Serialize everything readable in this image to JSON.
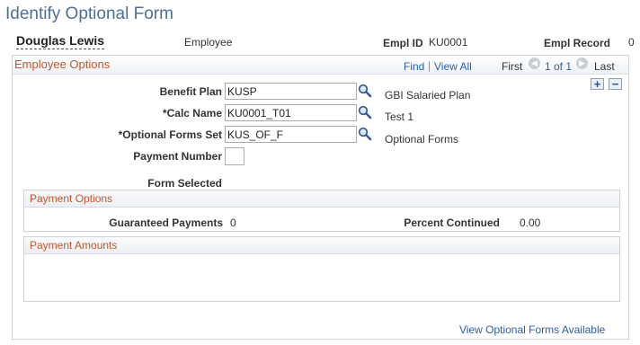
{
  "page": {
    "title": "Identify Optional Form"
  },
  "employee": {
    "name": "Douglas Lewis",
    "role": "Employee",
    "empl_id_label": "Empl ID",
    "empl_id": "KU0001",
    "empl_record_label": "Empl Record",
    "empl_record": "0"
  },
  "employee_options": {
    "title": "Employee Options",
    "nav": {
      "find": "Find",
      "separator": "|",
      "view_all": "View All",
      "first": "First",
      "page_info": "1 of 1",
      "last": "Last"
    },
    "add_symbol": "+",
    "delete_symbol": "−",
    "fields": {
      "benefit_plan": {
        "label": "Benefit Plan",
        "value": "KUSP",
        "description": "GBI Salaried Plan"
      },
      "calc_name": {
        "label": "*Calc Name",
        "value": "KU0001_T01",
        "description": "Test 1"
      },
      "optional_forms_set": {
        "label": "*Optional Forms Set",
        "value": "KUS_OF_F",
        "description": "Optional Forms"
      },
      "payment_number": {
        "label": "Payment Number",
        "value": ""
      },
      "form_selected": {
        "label": "Form Selected"
      }
    }
  },
  "payment_options": {
    "title": "Payment Options",
    "guaranteed_label": "Guaranteed Payments",
    "guaranteed_value": "0",
    "percent_label": "Percent Continued",
    "percent_value": "0.00"
  },
  "payment_amounts": {
    "title": "Payment Amounts"
  },
  "footer": {
    "view_link": "View Optional Forms Available"
  },
  "icons": {
    "lookup": "magnifier-icon",
    "prev": "left-arrow-icon",
    "next": "right-arrow-icon"
  },
  "colors": {
    "title": "#4d6f9a",
    "section": "#c0562c",
    "link": "#2d61a7"
  }
}
